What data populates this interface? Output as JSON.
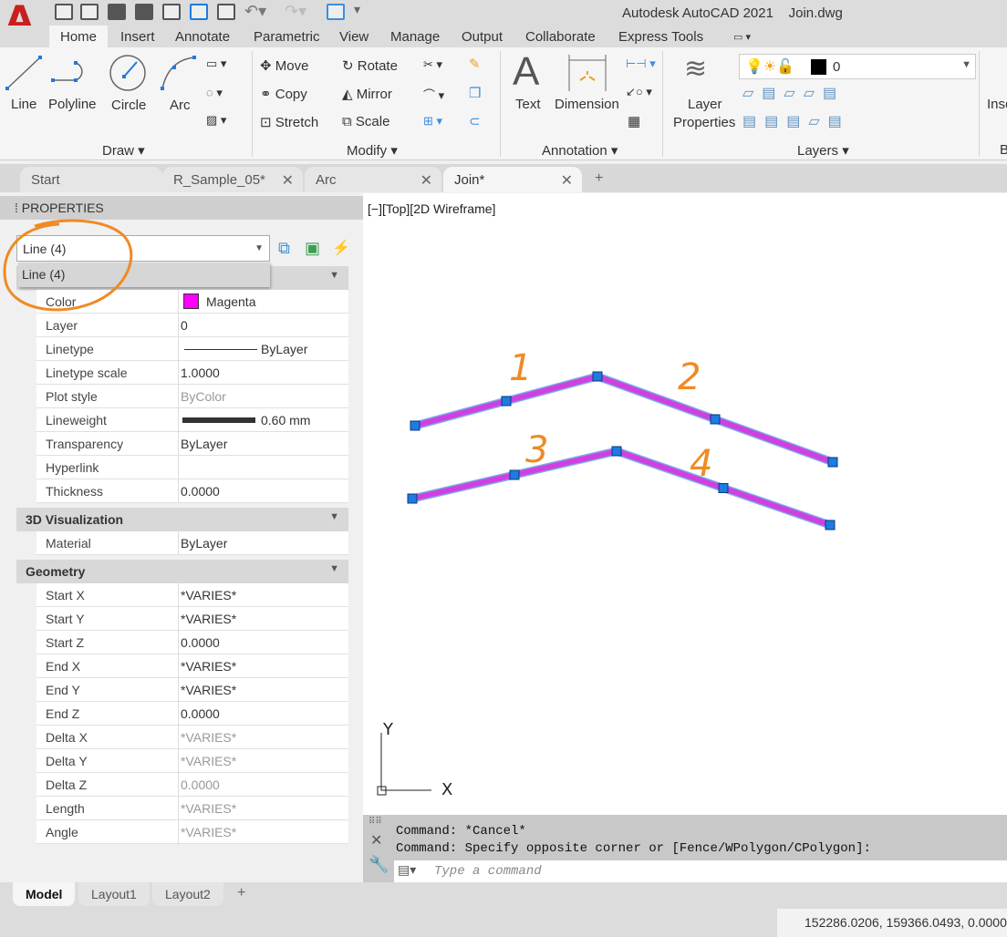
{
  "app": {
    "title": "Autodesk AutoCAD 2021",
    "file": "Join.dwg",
    "logo": "A"
  },
  "ribbon_tabs": [
    "Home",
    "Insert",
    "Annotate",
    "Parametric",
    "View",
    "Manage",
    "Output",
    "Collaborate",
    "Express Tools"
  ],
  "draw": {
    "line": "Line",
    "polyline": "Polyline",
    "circle": "Circle",
    "arc": "Arc",
    "panel": "Draw ▾"
  },
  "modify": {
    "move": "Move",
    "rotate": "Rotate",
    "copy": "Copy",
    "mirror": "Mirror",
    "stretch": "Stretch",
    "scale": "Scale",
    "panel": "Modify ▾"
  },
  "annotation": {
    "text": "Text",
    "dimension": "Dimension",
    "panel": "Annotation ▾"
  },
  "layers": {
    "layer_properties_1": "Layer",
    "layer_properties_2": "Properties",
    "current_layer": "0",
    "panel": "Layers ▾",
    "current_color": "#000000"
  },
  "insert_partial": "Inse",
  "block_partial": "B",
  "doc_tabs": [
    {
      "label": "Start"
    },
    {
      "label": "R_Sample_05*"
    },
    {
      "label": "Arc"
    },
    {
      "label": "Join*"
    }
  ],
  "properties": {
    "title": "PROPERTIES",
    "selection": "Line (4)",
    "dropdown_option": "Line (4)",
    "general": [
      {
        "label": "Color",
        "value": "Magenta",
        "swatch": "#ff00ff"
      },
      {
        "label": "Layer",
        "value": "0"
      },
      {
        "label": "Linetype",
        "value": "ByLayer"
      },
      {
        "label": "Linetype scale",
        "value": "1.0000"
      },
      {
        "label": "Plot style",
        "value": "ByColor",
        "disabled": true
      },
      {
        "label": "Lineweight",
        "value": "0.60 mm"
      },
      {
        "label": "Transparency",
        "value": "ByLayer"
      },
      {
        "label": "Hyperlink",
        "value": ""
      },
      {
        "label": "Thickness",
        "value": "0.0000"
      }
    ],
    "viz_title": "3D Visualization",
    "viz": [
      {
        "label": "Material",
        "value": "ByLayer"
      }
    ],
    "geom_title": "Geometry",
    "geometry": [
      {
        "label": "Start X",
        "value": "*VARIES*"
      },
      {
        "label": "Start Y",
        "value": "*VARIES*"
      },
      {
        "label": "Start Z",
        "value": "0.0000"
      },
      {
        "label": "End X",
        "value": "*VARIES*"
      },
      {
        "label": "End Y",
        "value": "*VARIES*"
      },
      {
        "label": "End Z",
        "value": "0.0000"
      },
      {
        "label": "Delta X",
        "value": "*VARIES*",
        "disabled": true
      },
      {
        "label": "Delta Y",
        "value": "*VARIES*",
        "disabled": true
      },
      {
        "label": "Delta Z",
        "value": "0.0000",
        "disabled": true
      },
      {
        "label": "Length",
        "value": "*VARIES*",
        "disabled": true
      },
      {
        "label": "Angle",
        "value": "*VARIES*",
        "disabled": true
      }
    ]
  },
  "viewport": {
    "label": "[−][Top][2D Wireframe]",
    "annotations": [
      "1",
      "2",
      "3",
      "4"
    ],
    "ucs_x": "X",
    "ucs_y": "Y",
    "line_color": "#d040e0",
    "grip_color": "#1e7be0",
    "annotation_color": "#f08a24"
  },
  "command": {
    "history": [
      "Command: *Cancel*",
      "Command: Specify opposite corner or [Fence/WPolygon/CPolygon]:"
    ],
    "placeholder": "Type a command"
  },
  "layout_tabs": [
    "Model",
    "Layout1",
    "Layout2"
  ],
  "status": {
    "coords": "152286.0206, 159366.0493, 0.0000"
  }
}
